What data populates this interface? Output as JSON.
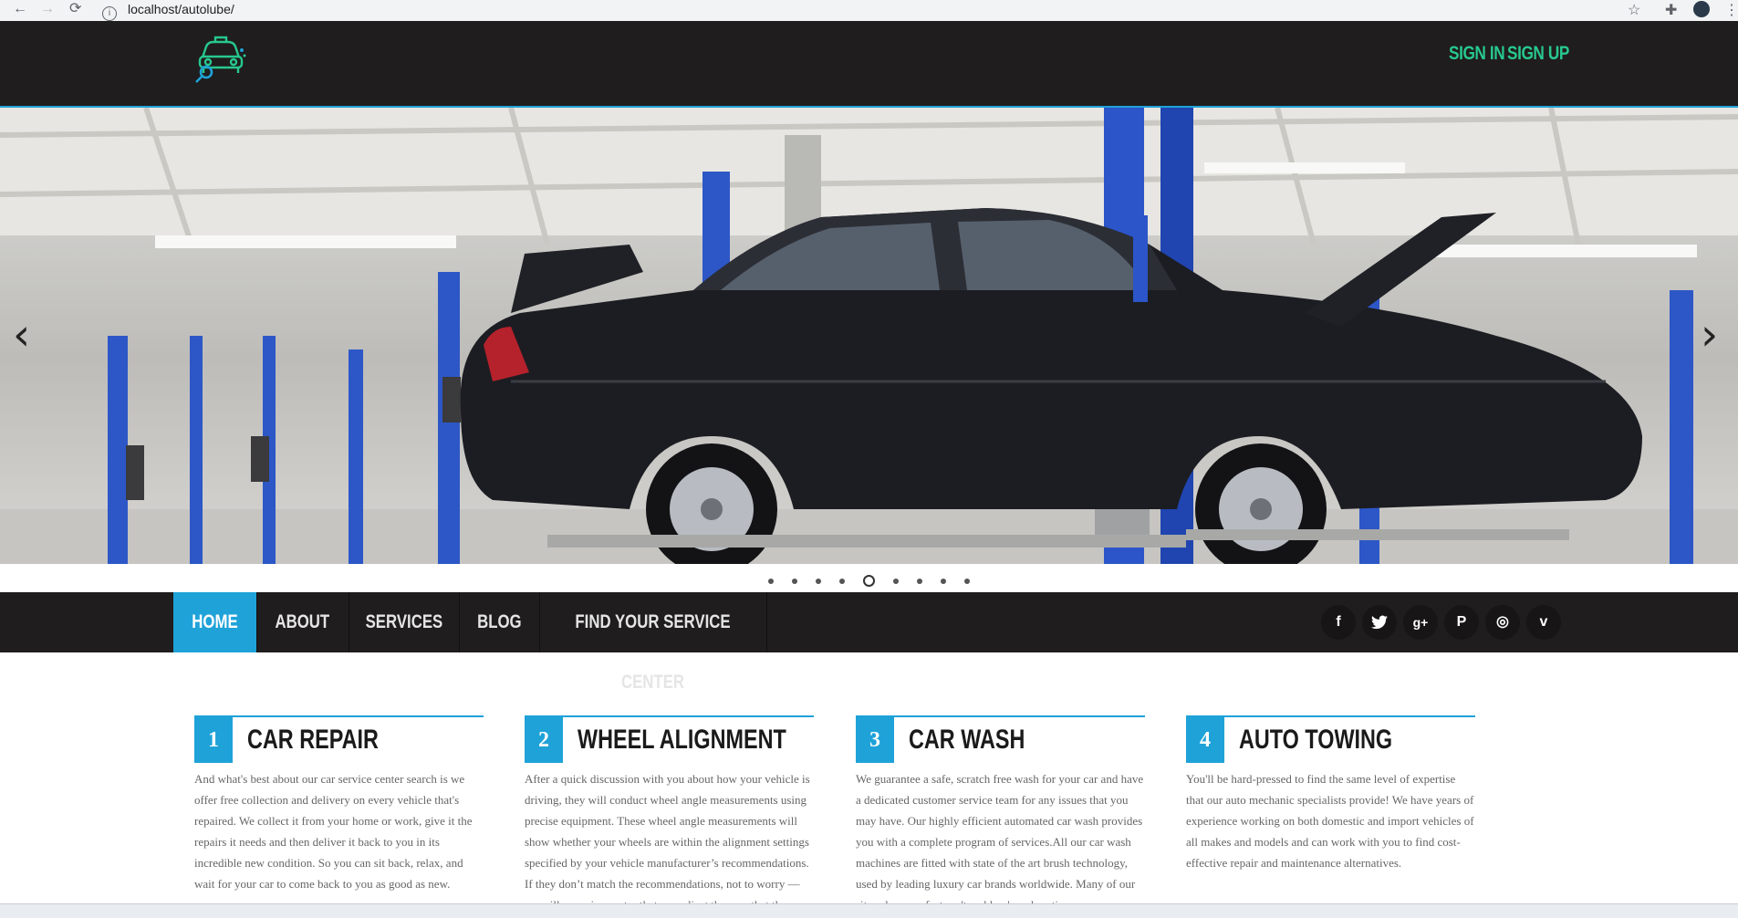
{
  "browser": {
    "url": "localhost/autolube/",
    "back_icon": "←",
    "forward_icon": "→",
    "reload_icon": "⟳",
    "star_icon": "☆",
    "extensions_icon": "✚",
    "menu_icon": "⋮"
  },
  "header": {
    "sign_in": "SIGN IN",
    "sign_up": "SIGN UP",
    "accent_color": "#27c88e"
  },
  "slider": {
    "prev_icon": "‹",
    "next_icon": "›",
    "dot_count": 9,
    "active_dot": 4
  },
  "nav": {
    "items": [
      {
        "label": "HOME"
      },
      {
        "label": "ABOUT"
      },
      {
        "label": "SERVICES"
      },
      {
        "label": "BLOG"
      },
      {
        "label": "FIND YOUR SERVICE CENTER"
      }
    ],
    "social": [
      {
        "glyph": "f",
        "name": "facebook"
      },
      {
        "glyph": "🐦",
        "name": "twitter"
      },
      {
        "glyph": "g+",
        "name": "google-plus"
      },
      {
        "glyph": "P",
        "name": "pinterest"
      },
      {
        "glyph": "◎",
        "name": "dribbble"
      },
      {
        "glyph": "v",
        "name": "vimeo"
      }
    ],
    "accent_color": "#1fa2d8"
  },
  "services": [
    {
      "number": "1",
      "title": "CAR REPAIR",
      "desc": "And what's best about our car service center search is we offer free collection and delivery on every vehicle that's repaired. We collect it from your home or work, give it the repairs it needs and then deliver it back to you in its incredible new condition. So you can sit back, relax, and wait for your car to come back to you as good as new."
    },
    {
      "number": "2",
      "title": "WHEEL ALIGNMENT",
      "desc": "After a quick discussion with you about how your vehicle is driving, they will conduct wheel angle measurements using precise equipment. These wheel angle measurements will show whether your wheels are within the alignment settings specified by your vehicle manufacturer’s recommendations. If they don’t match the recommendations, not to worry — we will a service center that can adjust them so that they"
    },
    {
      "number": "3",
      "title": "CAR WASH",
      "desc": "We guarantee a safe, scratch free wash for your car and have a dedicated customer service team for any issues that you may have. Our highly efficient automated car wash provides you with a complete program of services.All our car wash machines are fitted with state of the art brush technology, used by leading luxury car brands worldwide. Many of our sites also now feature 'touchless' wash options."
    },
    {
      "number": "4",
      "title": "AUTO TOWING",
      "desc": "You'll be hard-pressed to find the same level of expertise that our auto mechanic specialists provide! We have years of experience working on both domestic and import vehicles of all makes and models and can work with you to find cost-effective repair and maintenance alternatives."
    }
  ]
}
